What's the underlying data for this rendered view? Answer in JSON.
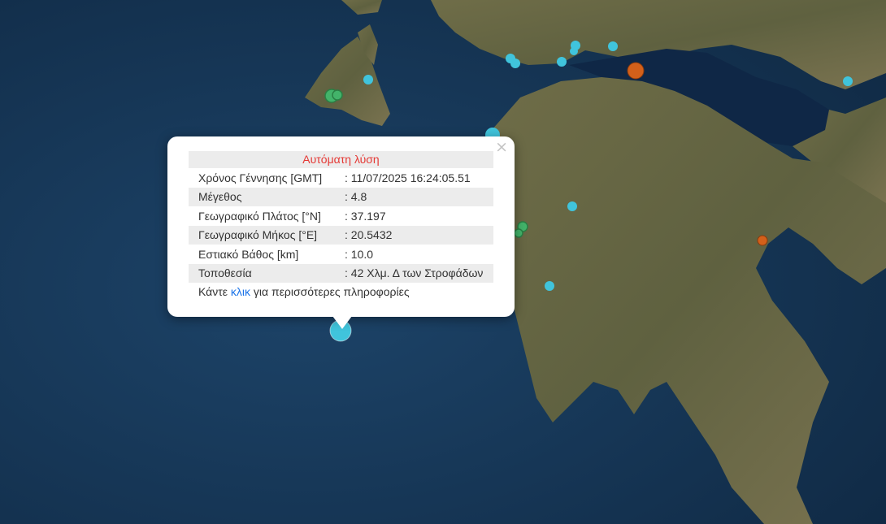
{
  "map": {
    "colors": {
      "sea_deep": "#14304d",
      "sea": "#1b3f62",
      "land": "#6b6a45",
      "land_dark": "#54573a",
      "gulf": "#0e2440",
      "marker_cyan": "#40c4dc",
      "marker_green": "#43b36a",
      "marker_orange": "#d3601a"
    },
    "markers": [
      {
        "id": "selected-event",
        "color": "cyan",
        "size": "large"
      },
      {
        "id": "event-1",
        "color": "green",
        "size": "small"
      },
      {
        "id": "event-2",
        "color": "cyan",
        "size": "small"
      },
      {
        "id": "event-3",
        "color": "orange",
        "size": "medium"
      },
      {
        "id": "event-4",
        "color": "orange",
        "size": "small"
      }
    ]
  },
  "popup": {
    "title": "Αυτόματη λύση",
    "close_icon": "×",
    "rows": [
      {
        "label": "Χρόνος Γέννησης [GMT]",
        "value": ": 11/07/2025 16:24:05.51"
      },
      {
        "label": "Μέγεθος",
        "value": ": 4.8"
      },
      {
        "label": "Γεωγραφικό Πλάτος [°N]",
        "value": ": 37.197"
      },
      {
        "label": "Γεωγραφικό Μήκος [°E]",
        "value": ": 20.5432"
      },
      {
        "label": "Εστιακό Βάθος [km]",
        "value": ": 10.0"
      },
      {
        "label": "Τοποθεσία",
        "value": ": 42 Χλμ. Δ των Στροφάδων"
      }
    ],
    "more_prefix": "Κάντε ",
    "more_link": "κλικ",
    "more_suffix": " για περισσότερες πληροφορίες"
  }
}
